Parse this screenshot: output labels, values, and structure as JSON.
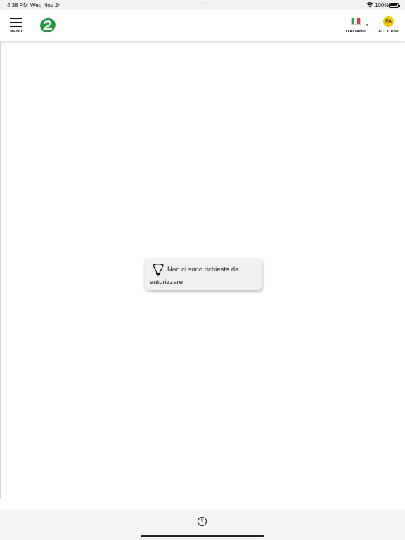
{
  "status_bar": {
    "time": "4:38 PM",
    "date": "Wed Nov 24",
    "battery": "100%"
  },
  "header": {
    "menu_label": "MENU",
    "language_label": "ITALIANO",
    "account_label": "ACCOUNT",
    "account_initials": "FA"
  },
  "empty_state": {
    "icon": "lightbulb-icon",
    "line1": "Non ci sono richieste da",
    "line2": "autorizzare"
  },
  "colors": {
    "avatar": "#f2c800",
    "logo_green": "#1a9a3a",
    "flag_green": "#3aa14a",
    "flag_red": "#d94040"
  }
}
